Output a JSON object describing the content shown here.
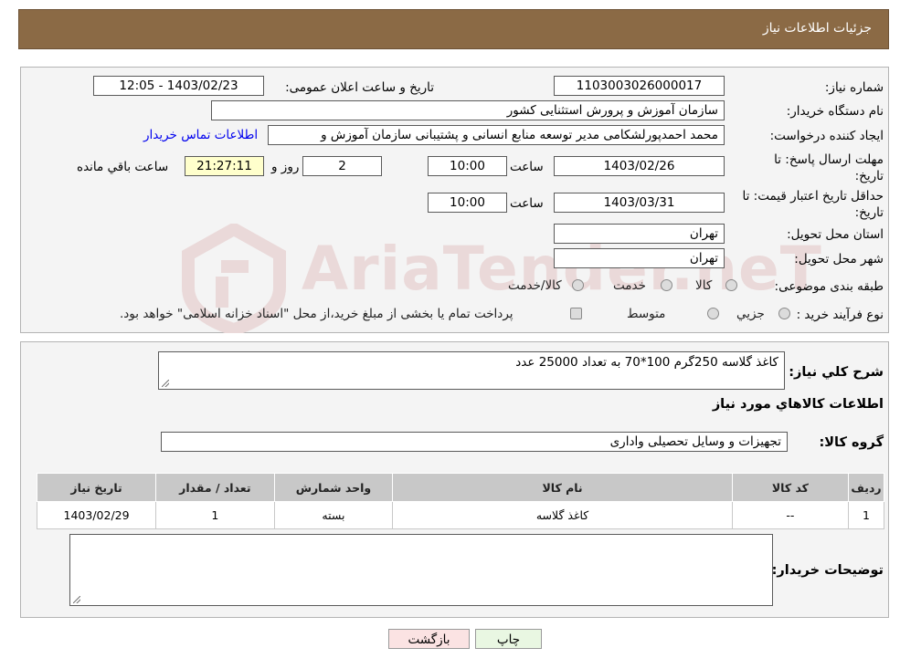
{
  "header": {
    "title": "جزئیات اطلاعات نیاز"
  },
  "watermark": {
    "text": "AriaTender.neT",
    "color": "#ead9d9"
  },
  "form": {
    "need_number_label": "شماره نیاز:",
    "need_number": "1103003026000017",
    "announce_label": "تاریخ و ساعت اعلان عمومی:",
    "announce_value": "1403/02/23 - 12:05",
    "buyer_org_label": "نام دستگاه خریدار:",
    "buyer_org": "سازمان آموزش و پرورش استثنایی کشور",
    "creator_label": "ایجاد کننده درخواست:",
    "creator": "محمد احمدپورلشکامی مدیر توسعه منابع انسانی و پشتیبانی سازمان آموزش و",
    "contact_link": "اطلاعات تماس خریدار",
    "deadline_label_1": "مهلت ارسال پاسخ: تا",
    "deadline_label_2": "تاریخ:",
    "deadline_date": "1403/02/26",
    "time_label": "ساعت",
    "deadline_time": "10:00",
    "days_value": "2",
    "days_label": "روز و",
    "remaining_time": "21:27:11",
    "remaining_label": "ساعت باقي مانده",
    "validity_label_1": "حداقل تاریخ اعتبار قیمت: تا",
    "validity_label_2": "تاریخ:",
    "validity_date": "1403/03/31",
    "validity_time": "10:00",
    "province_label": "استان محل تحویل:",
    "province": "تهران",
    "city_label": "شهر محل تحویل:",
    "city": "تهران",
    "category_label": "طبقه بندی موضوعی:",
    "category_options": [
      "کالا",
      "خدمت",
      "کالا/خدمت"
    ],
    "purchase_type_label": "نوع فرآیند خرید :",
    "purchase_options": [
      "جزيي",
      "متوسط"
    ],
    "purchase_note": "پرداخت تمام یا بخشی از مبلغ خرید،از محل \"اسناد خزانه اسلامی\" خواهد بود."
  },
  "details": {
    "description_label": "شرح کلي نياز:",
    "description": "کاغذ گلاسه 250گرم 100*70 به تعداد 25000 عدد",
    "goods_info_title": "اطلاعات کالاهاي مورد نياز",
    "goods_group_label": "گروه کالا:",
    "goods_group": "تجهیزات و وسایل تحصیلی واداری",
    "table": {
      "headers": [
        "رديف",
        "کد کالا",
        "نام کالا",
        "واحد شمارش",
        "تعداد / مقدار",
        "تاریخ نیاز"
      ],
      "rows": [
        [
          "1",
          "--",
          "کاغذ گلاسه",
          "بسته",
          "1",
          "1403/02/29"
        ]
      ]
    },
    "buyer_notes_label": "توضیحات خریدار:",
    "buyer_notes": ""
  },
  "buttons": {
    "print": "چاپ",
    "back": "بازگشت"
  }
}
